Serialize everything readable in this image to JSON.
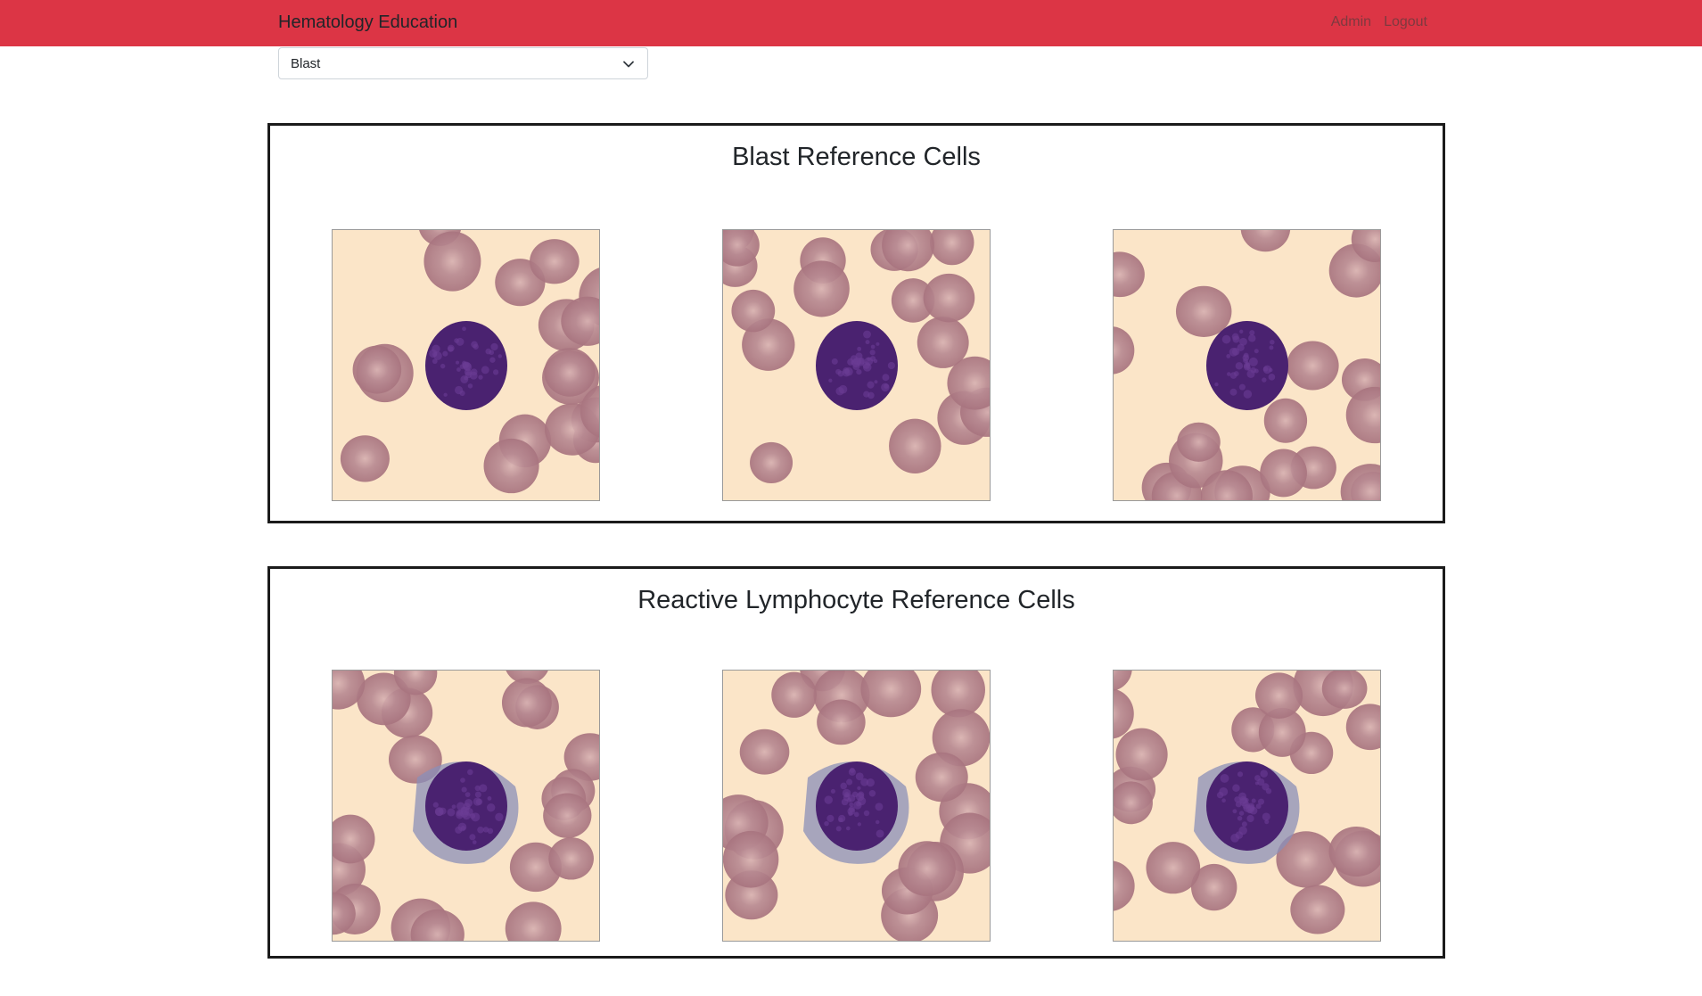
{
  "navbar": {
    "brand": "Hematology Education",
    "links": [
      "Admin",
      "Logout"
    ],
    "background_color": "#dc3545"
  },
  "filter": {
    "selected": "Blast",
    "icon": "chevron-down-icon"
  },
  "sections": [
    {
      "title": "Blast Reference Cells",
      "images": [
        {
          "name": "blast-cell-image-1"
        },
        {
          "name": "blast-cell-image-2"
        },
        {
          "name": "blast-cell-image-3"
        }
      ]
    },
    {
      "title": "Reactive Lymphocyte Reference Cells",
      "images": [
        {
          "name": "reactive-lymphocyte-image-1"
        },
        {
          "name": "reactive-lymphocyte-image-2"
        },
        {
          "name": "reactive-lymphocyte-image-3"
        }
      ]
    }
  ],
  "colors": {
    "smear_background": "#fbe5c8",
    "red_cell": "#a8747f",
    "nucleus": "#4a2270",
    "cytoplasm": "#8b8fb8"
  }
}
